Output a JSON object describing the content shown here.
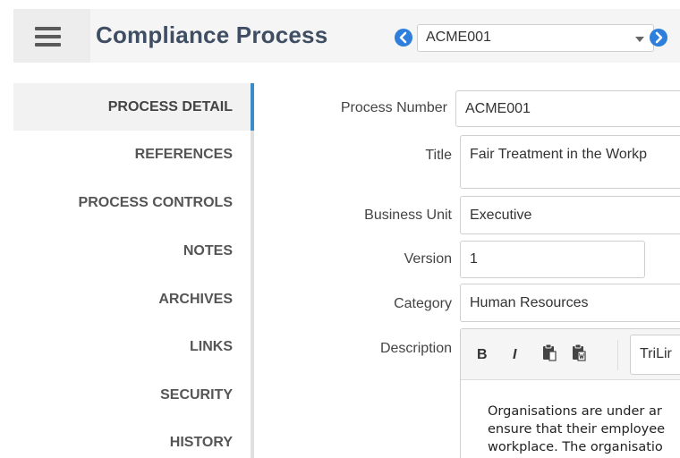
{
  "header": {
    "title": "Compliance Process",
    "selected_process": "ACME001"
  },
  "sidebar": {
    "items": [
      {
        "label": "PROCESS DETAIL"
      },
      {
        "label": "REFERENCES"
      },
      {
        "label": "PROCESS CONTROLS"
      },
      {
        "label": "NOTES"
      },
      {
        "label": "ARCHIVES"
      },
      {
        "label": "LINKS"
      },
      {
        "label": "SECURITY"
      },
      {
        "label": "HISTORY"
      }
    ]
  },
  "form": {
    "process_number": {
      "label": "Process Number",
      "value": "ACME001"
    },
    "title": {
      "label": "Title",
      "value": "Fair Treatment in the Workp"
    },
    "business_unit": {
      "label": "Business Unit",
      "value": "Executive"
    },
    "version": {
      "label": "Version",
      "value": "1"
    },
    "category": {
      "label": "Category",
      "value": "Human Resources"
    },
    "description": {
      "label": "Description",
      "toolbar": {
        "bold": "B",
        "italic": "I",
        "font": "TriLir"
      },
      "lines": [
        "Organisations are under ar",
        "ensure that their employee",
        "workplace. The organisatio"
      ]
    }
  },
  "colors": {
    "header_title": "#3f4e63",
    "nav_accent": "#2d7fdb",
    "active_rail": "#3c8dc7"
  }
}
